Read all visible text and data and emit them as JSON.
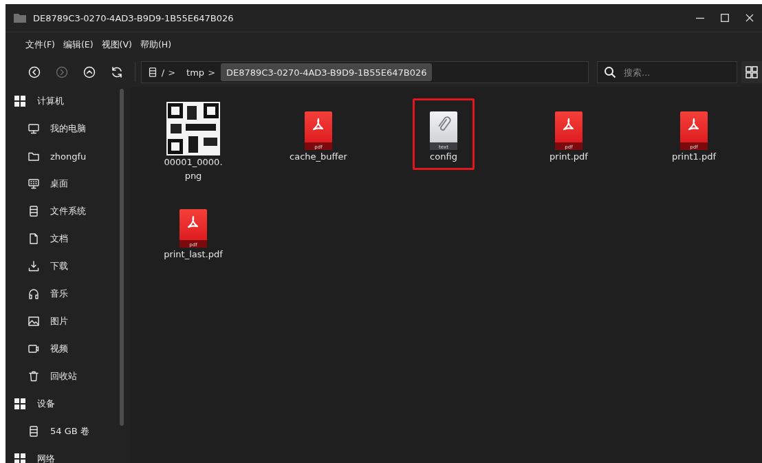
{
  "window": {
    "title": "DE8789C3-0270-4AD3-B9D9-1B55E647B026"
  },
  "menu": [
    "文件(F)",
    "编辑(E)",
    "视图(V)",
    "帮助(H)"
  ],
  "toolbar": {
    "back_disabled": false,
    "forward_disabled": true,
    "up_disabled": false
  },
  "breadcrumbs": [
    {
      "label": "/",
      "kind": "root",
      "selected": false
    },
    {
      "label": "tmp",
      "kind": "folder",
      "selected": false
    },
    {
      "label": "DE8789C3-0270-4AD3-B9D9-1B55E647B026",
      "kind": "folder",
      "selected": true
    }
  ],
  "breadcrumb_separator": ">",
  "search": {
    "placeholder": "搜索..."
  },
  "sidebar": [
    {
      "label": "计算机",
      "children": [
        {
          "label": "我的电脑",
          "kind": "computer"
        },
        {
          "label": "zhongfu",
          "kind": "home"
        },
        {
          "label": "桌面",
          "kind": "desktop"
        },
        {
          "label": "文件系统",
          "kind": "filesystem"
        },
        {
          "label": "文档",
          "kind": "documents"
        },
        {
          "label": "下载",
          "kind": "downloads"
        },
        {
          "label": "音乐",
          "kind": "music"
        },
        {
          "label": "图片",
          "kind": "pictures"
        },
        {
          "label": "视频",
          "kind": "videos"
        },
        {
          "label": "回收站",
          "kind": "trash"
        }
      ]
    },
    {
      "label": "设备",
      "children": [
        {
          "label": "54 GB 卷",
          "kind": "volume"
        }
      ]
    },
    {
      "label": "网络"
    }
  ],
  "files": [
    {
      "name": "00001_0000.png",
      "kind": "picture",
      "selected": false
    },
    {
      "name": "cache_buffer",
      "kind": "pdf",
      "badge": "pdf",
      "selected": false
    },
    {
      "name": "config",
      "kind": "text",
      "badge": "text",
      "selected": true
    },
    {
      "name": "print.pdf",
      "kind": "pdf",
      "badge": "pdf",
      "selected": false
    },
    {
      "name": "print1.pdf",
      "kind": "pdf",
      "badge": "pdf",
      "selected": false
    },
    {
      "name": "print_last.pdf",
      "kind": "pdf",
      "badge": "pdf",
      "selected": false
    }
  ]
}
